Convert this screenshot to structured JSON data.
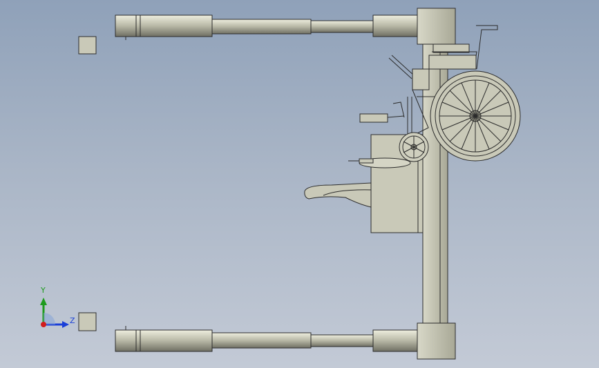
{
  "viewport": {
    "background_top": "#8fa1b9",
    "background_bottom": "#c3cad6",
    "model_fill": "#c9c9b8",
    "model_stroke": "#2b2b2b"
  },
  "model": {
    "parts": [
      "upper-arm",
      "lower-arm",
      "vertical-column",
      "wheelchair",
      "lift-seat",
      "leg-rest",
      "small-wheel",
      "large-wheel"
    ]
  },
  "triad": {
    "y_label": "Y",
    "z_label": "Z",
    "x_color": "#d11d1d",
    "y_color": "#1e9b1e",
    "z_color": "#1a3fd8"
  }
}
